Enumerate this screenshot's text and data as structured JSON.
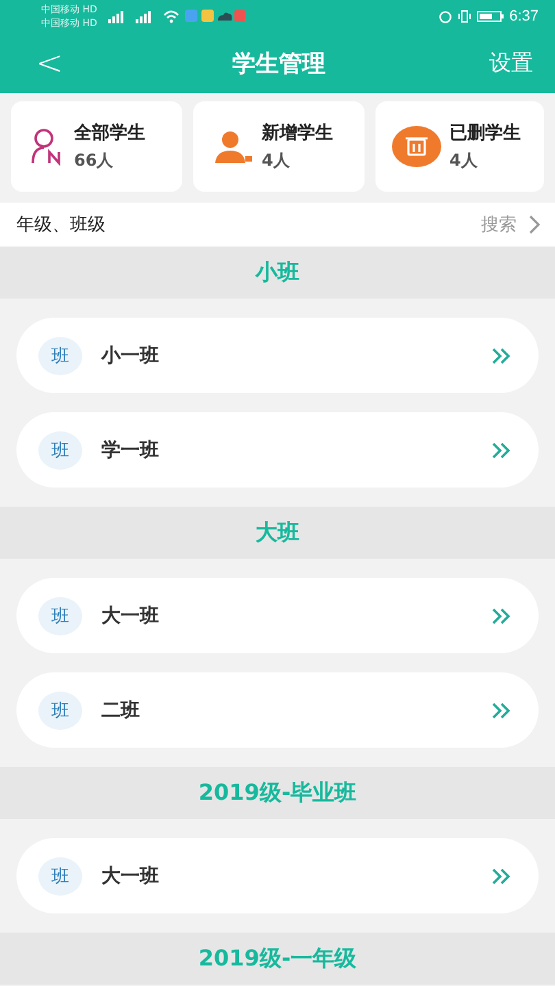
{
  "status_bar": {
    "carriers": [
      "中国移动 HD",
      "中国移动 HD"
    ],
    "time": "6:37"
  },
  "nav": {
    "back": "<",
    "title": "学生管理",
    "action": "设置"
  },
  "stats": [
    {
      "kind": "all",
      "label": "全部学生",
      "count": "66人"
    },
    {
      "kind": "new",
      "label": "新增学生",
      "count": "4人"
    },
    {
      "kind": "deleted",
      "label": "已删学生",
      "count": "4人"
    }
  ],
  "filter": {
    "label": "年级、班级",
    "search": "搜索"
  },
  "groups": [
    {
      "title": "小班",
      "classes": [
        {
          "badge": "班",
          "name": "小一班"
        },
        {
          "badge": "班",
          "name": "学一班"
        }
      ]
    },
    {
      "title": "大班",
      "classes": [
        {
          "badge": "班",
          "name": "大一班"
        },
        {
          "badge": "班",
          "name": "二班"
        }
      ]
    },
    {
      "title": "2019级-毕业班",
      "classes": [
        {
          "badge": "班",
          "name": "大一班"
        }
      ]
    },
    {
      "title": "2019级-一年级"
    }
  ]
}
